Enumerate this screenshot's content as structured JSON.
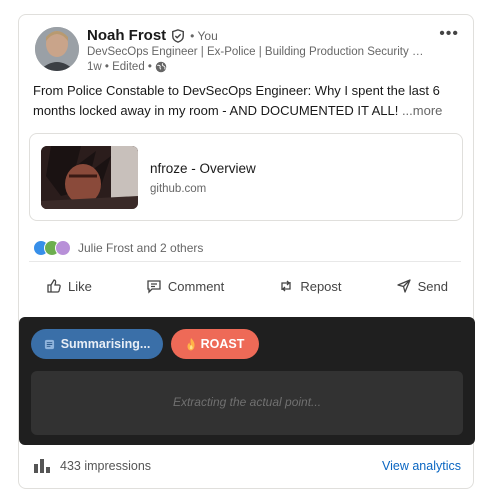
{
  "author": {
    "name": "Noah Frost",
    "you_label": "• You",
    "headline": "DevSecOps Engineer | Ex-Police | Building Production Security + AI A...",
    "meta": "1w • Edited •"
  },
  "post": {
    "text": "From Police Constable to DevSecOps Engineer: Why I spent the last 6 months locked away in my room - AND DOCUMENTED IT ALL!",
    "see_more": "...more"
  },
  "link_preview": {
    "title": "nfroze - Overview",
    "domain": "github.com"
  },
  "reactions": {
    "text": "Julie Frost and 2 others"
  },
  "actions": {
    "like": "Like",
    "comment": "Comment",
    "repost": "Repost",
    "send": "Send"
  },
  "ai_panel": {
    "summarise_label": "Summarising...",
    "roast_label": "ROAST",
    "output_placeholder": "Extracting the actual point..."
  },
  "footer": {
    "impressions": "433 impressions",
    "analytics_link": "View analytics"
  },
  "colors": {
    "accent_blue": "#0a66c2",
    "summarise_bg": "#3a6fa8",
    "roast_bg": "#ee6a57",
    "panel_bg": "#1f1f1f"
  }
}
